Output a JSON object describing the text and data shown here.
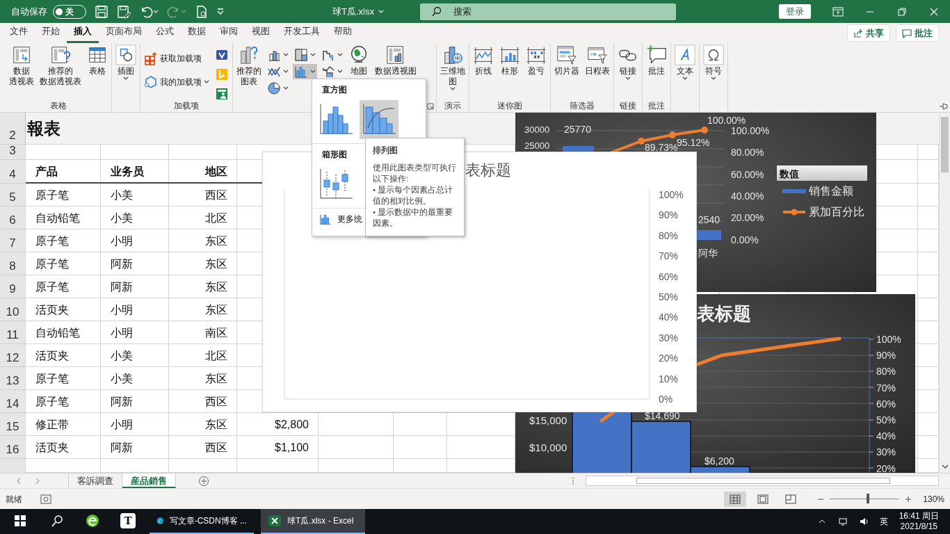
{
  "title_bar": {
    "autosave_label": "自动保存",
    "autosave_toggle": {
      "label": "关",
      "on": false
    },
    "quick_access": [
      {
        "kind": "save",
        "disabled": false,
        "menu": false
      },
      {
        "kind": "save-as",
        "disabled": false,
        "menu": false
      },
      {
        "kind": "undo",
        "disabled": false,
        "menu": true
      },
      {
        "kind": "redo",
        "disabled": true,
        "menu": true
      },
      {
        "kind": "preview",
        "disabled": false,
        "menu": false
      },
      {
        "kind": "customize",
        "disabled": false
      }
    ],
    "file_name": "球T瓜.xlsx",
    "search_placeholder": "搜索",
    "sign_in": "登录"
  },
  "ribbon_tabs": [
    {
      "label": "文件",
      "selected": false
    },
    {
      "label": "开始",
      "selected": false
    },
    {
      "label": "插入",
      "selected": true
    },
    {
      "label": "页面布局",
      "selected": false
    },
    {
      "label": "公式",
      "selected": false
    },
    {
      "label": "数据",
      "selected": false
    },
    {
      "label": "审阅",
      "selected": false
    },
    {
      "label": "视图",
      "selected": false
    },
    {
      "label": "开发工具",
      "selected": false
    },
    {
      "label": "帮助",
      "selected": false
    }
  ],
  "share_button": "共享",
  "comments_button": "批注",
  "ribbon_groups": [
    {
      "label": "表格",
      "columns": [
        [
          {
            "kind": "pivot-table",
            "lines": [
              "数据",
              "透视表"
            ]
          }
        ],
        [
          {
            "kind": "recommended-pivot",
            "lines": [
              "推荐的",
              "数据透视表"
            ]
          }
        ],
        [
          {
            "kind": "table",
            "lines": [
              "表格"
            ]
          }
        ]
      ]
    },
    {
      "columns": [
        [
          {
            "kind": "shapes",
            "lines": [
              "插图"
            ],
            "menu": true
          }
        ]
      ]
    },
    {
      "label": "加载项",
      "columns": [
        [
          {
            "kind": "store",
            "label": "获取加载项"
          },
          {
            "kind": "addins",
            "label": "我的加载项",
            "menu": true
          }
        ],
        [
          {
            "kind": "visio"
          },
          {
            "kind": "bing"
          },
          {
            "kind": "people"
          }
        ]
      ]
    },
    {
      "launcher": true,
      "columns": [
        [
          {
            "kind": "recommended-charts",
            "lines": [
              "推荐的",
              "图表"
            ]
          }
        ],
        [
          {
            "kind": "column",
            "menu": true,
            "pressed": false
          },
          {
            "kind": "line-chart",
            "menu": true,
            "pressed": false
          },
          {
            "kind": "pie",
            "menu": true,
            "pressed": false
          }
        ],
        [
          {
            "kind": "treemap",
            "menu": true,
            "pressed": false
          },
          {
            "kind": "histogram",
            "menu": true,
            "pressed": true
          }
        ],
        [
          {
            "kind": "waterfall",
            "menu": true,
            "pressed": false
          },
          {
            "kind": "combo",
            "menu": true,
            "pressed": false
          }
        ],
        [
          {
            "kind": "globe",
            "lines": [
              "地图"
            ]
          }
        ],
        [
          {
            "kind": "pivot-chart",
            "lines": [
              "数据透视图"
            ]
          }
        ]
      ]
    },
    {
      "label": "演示",
      "columns": [
        [
          {
            "kind": "map3d",
            "lines": [
              "三维地",
              "图"
            ],
            "menu": true
          }
        ]
      ]
    },
    {
      "label": "迷你图",
      "columns": [
        [
          {
            "kind": "spark-line",
            "lines": [
              "折线"
            ]
          }
        ],
        [
          {
            "kind": "spark-column",
            "lines": [
              "柱形"
            ]
          }
        ],
        [
          {
            "kind": "winloss",
            "lines": [
              "盈亏"
            ]
          }
        ]
      ]
    },
    {
      "label": "筛选器",
      "columns": [
        [
          {
            "kind": "slicer",
            "lines": [
              "切片器"
            ]
          }
        ],
        [
          {
            "kind": "timeline",
            "lines": [
              "日程表"
            ]
          }
        ]
      ]
    },
    {
      "label": "链接",
      "columns": [
        [
          {
            "kind": "link",
            "lines": [
              "链接"
            ],
            "menu": true
          }
        ]
      ]
    },
    {
      "label": "批注",
      "columns": [
        [
          {
            "kind": "comment",
            "lines": [
              "批注"
            ]
          }
        ]
      ]
    },
    {
      "columns": [
        [
          {
            "kind": "text",
            "lines": [
              "文本"
            ],
            "menu": true
          }
        ]
      ]
    },
    {
      "columns": [
        [
          {
            "kind": "omega",
            "lines": [
              "符号"
            ],
            "menu": true
          }
        ]
      ]
    }
  ],
  "sheet": {
    "rows": [
      {
        "number": "2",
        "kind": "title",
        "cells": [
          "報表"
        ]
      },
      {
        "number": "3",
        "kind": "blank",
        "cells": []
      },
      {
        "number": "4",
        "kind": "header",
        "cells": [
          "产品",
          "业务员",
          "地区"
        ]
      },
      {
        "number": "5",
        "kind": "data",
        "cells": [
          "原子笔",
          "小美",
          "西区"
        ]
      },
      {
        "number": "6",
        "kind": "data",
        "cells": [
          "自动铅笔",
          "小美",
          "北区"
        ]
      },
      {
        "number": "7",
        "kind": "data",
        "cells": [
          "原子笔",
          "小明",
          "东区"
        ]
      },
      {
        "number": "8",
        "kind": "data",
        "cells": [
          "原子笔",
          "阿新",
          "东区"
        ]
      },
      {
        "number": "9",
        "kind": "data",
        "cells": [
          "原子笔",
          "阿新",
          "东区"
        ]
      },
      {
        "number": "10",
        "kind": "data",
        "cells": [
          "活页夹",
          "小明",
          "东区"
        ]
      },
      {
        "number": "11",
        "kind": "data",
        "cells": [
          "自动铅笔",
          "小明",
          "南区"
        ]
      },
      {
        "number": "12",
        "kind": "data",
        "cells": [
          "活页夹",
          "小美",
          "北区"
        ]
      },
      {
        "number": "13",
        "kind": "data",
        "cells": [
          "原子笔",
          "小美",
          "东区"
        ]
      },
      {
        "number": "14",
        "kind": "data",
        "cells": [
          "原子笔",
          "阿新",
          "西区"
        ]
      },
      {
        "number": "15",
        "kind": "data",
        "cells": [
          "修正带",
          "小明",
          "东区",
          "$2,800"
        ]
      },
      {
        "number": "16",
        "kind": "data",
        "cells": [
          "活页夹",
          "阿新",
          "西区",
          "$1,100"
        ]
      }
    ]
  },
  "chart_1": {
    "left_axis": [
      "30000",
      "25000"
    ],
    "data_labels": [
      "25770",
      "89.73%",
      "95.12%",
      "100.00%",
      "2540"
    ],
    "right_axis": [
      "100.00%",
      "80.00%",
      "60.00%",
      "40.00%",
      "20.00%",
      "0.00%"
    ],
    "category": "阿华",
    "legend": {
      "title": "数值",
      "items": [
        "销售金额",
        "累加百分比"
      ]
    }
  },
  "chart_2": {
    "title": "表标题",
    "left_axis": [
      "$15,000",
      "$10,000"
    ],
    "data_labels": [
      "$14,690",
      "$6,200"
    ],
    "right_axis": [
      "100%",
      "90%",
      "80%",
      "70%",
      "60%",
      "50%",
      "40%",
      "30%",
      "20%"
    ]
  },
  "preview_chart": {
    "title": "表标题",
    "right_axis": [
      "100%",
      "90%",
      "80%",
      "70%",
      "60%",
      "50%",
      "40%",
      "30%",
      "20%",
      "10%",
      "0%"
    ]
  },
  "chart_menu": {
    "sections": [
      {
        "title": "直方图",
        "items": [
          {
            "kind": "histogram",
            "selected": false
          },
          {
            "kind": "pareto",
            "selected": true
          }
        ]
      },
      {
        "title": "箱形图",
        "items": [
          {
            "kind": "box-whisker",
            "selected": false
          }
        ]
      }
    ],
    "more": "更多统"
  },
  "tooltip": {
    "title": "排列图",
    "paragraphs": [
      "使用此图表类型可执行以下操作:",
      "• 显示每个因素占总计值的相对比例。",
      "• 显示数据中的最重要因素。"
    ]
  },
  "sheet_tabs": [
    {
      "label": "客訴調查",
      "selected": false
    },
    {
      "label": "産品銷售",
      "selected": true
    }
  ],
  "status_bar": {
    "ready": "就绪",
    "views": [
      {
        "kind": "normal",
        "selected": true
      },
      {
        "kind": "page-layout",
        "selected": false
      },
      {
        "kind": "page-break",
        "selected": false
      }
    ],
    "zoom": {
      "level": 0.55,
      "reading": "130%"
    }
  },
  "taskbar": {
    "apps": [
      {
        "kind": "start",
        "active": false
      },
      {
        "kind": "search",
        "active": false
      },
      {
        "kind": "browser",
        "active": false
      },
      {
        "kind": "letter-app",
        "glyph": "T",
        "active": false
      },
      {
        "kind": "edge",
        "label": "写文章-CSDN博客 ...",
        "active": false
      },
      {
        "kind": "excel",
        "label": "球T瓜.xlsx - Excel",
        "active": true
      }
    ],
    "ime": "英",
    "time": "16:41 周日",
    "date": "2021/8/15"
  }
}
